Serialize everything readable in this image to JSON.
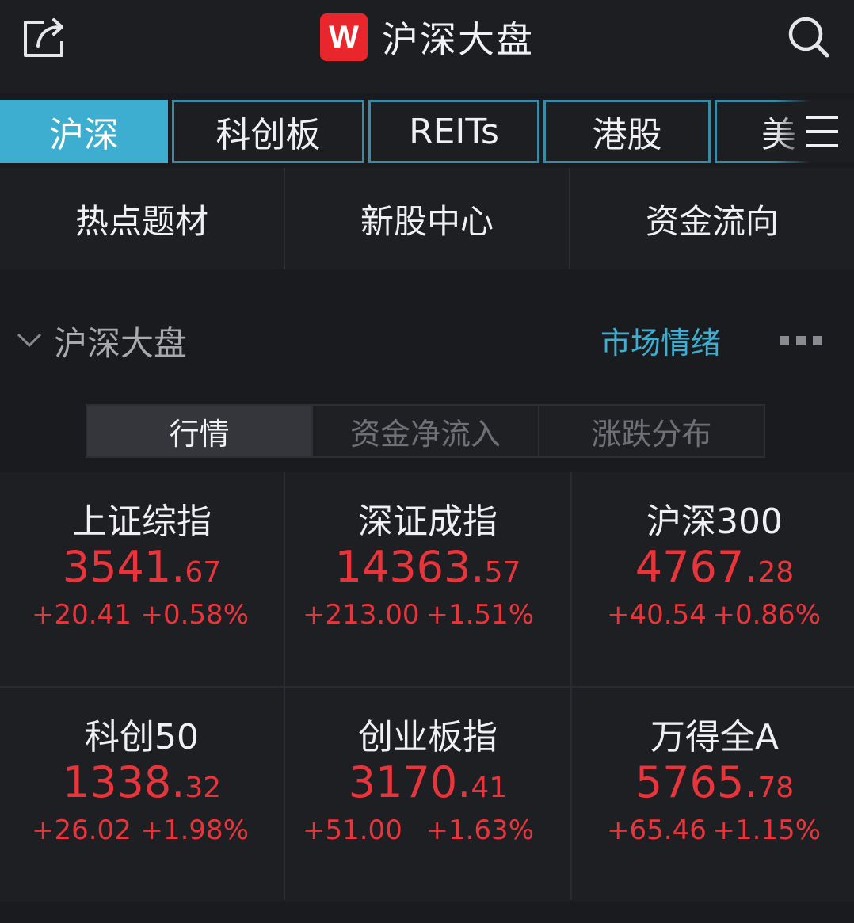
{
  "header": {
    "title": "沪深大盘",
    "logo_letter": "W",
    "logo_color": "#e8262b",
    "share_icon": "share-icon",
    "search_icon": "search-icon"
  },
  "market_tabs": [
    {
      "label": "沪深",
      "active": true
    },
    {
      "label": "科创板",
      "active": false
    },
    {
      "label": "REITs",
      "active": false
    },
    {
      "label": "港股",
      "active": false
    },
    {
      "label": "美",
      "active": false
    }
  ],
  "menu_icon": "menu-icon",
  "quick_links": [
    "热点题材",
    "新股中心",
    "资金流向"
  ],
  "section": {
    "title": "沪深大盘",
    "link": "市场情绪",
    "more_icon": "more-icon"
  },
  "segments": [
    {
      "label": "行情",
      "active": true
    },
    {
      "label": "资金净流入",
      "active": false
    },
    {
      "label": "涨跌分布",
      "active": false
    }
  ],
  "indices": [
    {
      "name": "上证综指",
      "price_int": "3541.",
      "price_dec": "67",
      "change": "+20.41",
      "pct": "+0.58%"
    },
    {
      "name": "深证成指",
      "price_int": "14363.",
      "price_dec": "57",
      "change": "+213.00",
      "pct": "+1.51%"
    },
    {
      "name": "沪深300",
      "price_int": "4767.",
      "price_dec": "28",
      "change": "+40.54",
      "pct": "+0.86%"
    },
    {
      "name": "科创50",
      "price_int": "1338.",
      "price_dec": "32",
      "change": "+26.02",
      "pct": "+1.98%"
    },
    {
      "name": "创业板指",
      "price_int": "3170.",
      "price_dec": "41",
      "change": "+51.00",
      "pct": "+1.63%"
    },
    {
      "name": "万得全A",
      "price_int": "5765.",
      "price_dec": "78",
      "change": "+65.46",
      "pct": "+1.15%"
    }
  ],
  "colors": {
    "accent": "#3eaed0",
    "up": "#e8353c",
    "background": "#1a1b1f"
  }
}
